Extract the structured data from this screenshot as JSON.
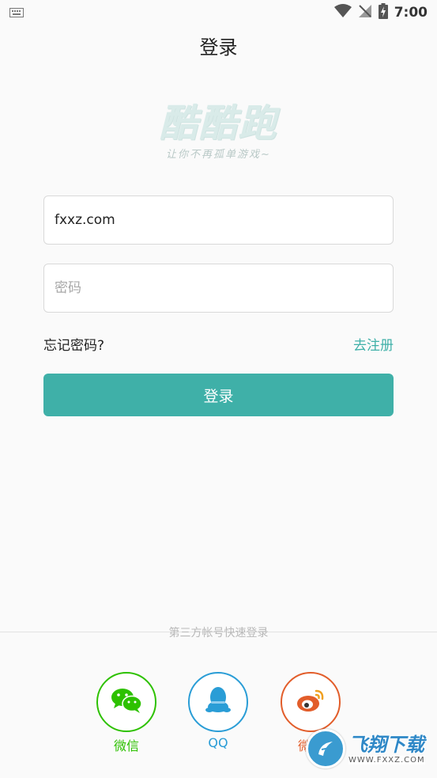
{
  "status_bar": {
    "time": "7:00",
    "icons": [
      "keyboard-icon",
      "wifi-icon",
      "no-signal-icon",
      "battery-charging-icon"
    ]
  },
  "header": {
    "title": "登录"
  },
  "logo": {
    "text": "酷酷跑",
    "slogan": "让你不再孤单游戏~"
  },
  "form": {
    "username_value": "fxxz.com",
    "password_placeholder": "密码",
    "forgot_label": "忘记密码?",
    "register_label": "去注册",
    "login_label": "登录"
  },
  "third_party": {
    "label": "第三方帐号快速登录",
    "items": [
      {
        "label": "微信",
        "icon": "wechat-icon",
        "color": "#2dc100"
      },
      {
        "label": "QQ",
        "icon": "qq-icon",
        "color": "#2a9dd6"
      },
      {
        "label": "微博",
        "icon": "weibo-icon",
        "color": "#e25d2a"
      }
    ]
  },
  "watermark": {
    "title": "飞翔下载",
    "url": "WWW.FXXZ.COM"
  },
  "colors": {
    "accent": "#3fb0a8",
    "background": "#fafafa"
  }
}
